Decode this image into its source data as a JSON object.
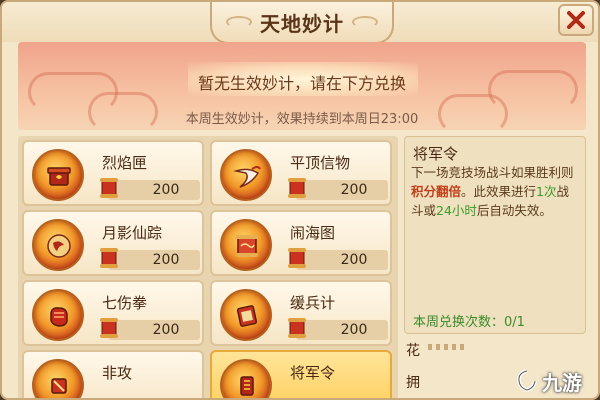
{
  "window": {
    "title": "天地妙计"
  },
  "banner": {
    "main_text": "暂无生效妙计，请在下方兑换",
    "sub_text": "本周生效妙计，效果持续到本周日23:00"
  },
  "cards": [
    {
      "name": "烈焰匣",
      "cost": "200",
      "icon": "flame-box-icon",
      "selected": false
    },
    {
      "name": "平顶信物",
      "cost": "200",
      "icon": "claw-token-icon",
      "selected": false
    },
    {
      "name": "月影仙踪",
      "cost": "200",
      "icon": "moon-trace-icon",
      "selected": false
    },
    {
      "name": "闹海图",
      "cost": "200",
      "icon": "sea-scroll-icon",
      "selected": false
    },
    {
      "name": "七伤拳",
      "cost": "200",
      "icon": "fist-icon",
      "selected": false
    },
    {
      "name": "缓兵计",
      "cost": "200",
      "icon": "delay-scroll-icon",
      "selected": false
    },
    {
      "name": "非攻",
      "cost": "",
      "icon": "non-attack-icon",
      "selected": false
    },
    {
      "name": "将军令",
      "cost": "",
      "icon": "general-order-icon",
      "selected": true
    }
  ],
  "detail": {
    "title": "将军令",
    "desc_part1": "下一场竞技场战斗如果胜利则",
    "desc_highlight": "积分翻倍",
    "desc_part2": "。此效果进行",
    "desc_n1": "1次",
    "desc_part3": "战斗或",
    "desc_n2": "24小时",
    "desc_part4": "后自动失效。",
    "weekly_count": "本周兑换次数：0/1"
  },
  "bottom": {
    "label1": "花",
    "label2": "拥"
  },
  "watermark": {
    "text": "九游"
  },
  "colors": {
    "accent_red": "#c0401a",
    "accent_green": "#3a9a2a",
    "selected_card": "#ffcf5e"
  }
}
